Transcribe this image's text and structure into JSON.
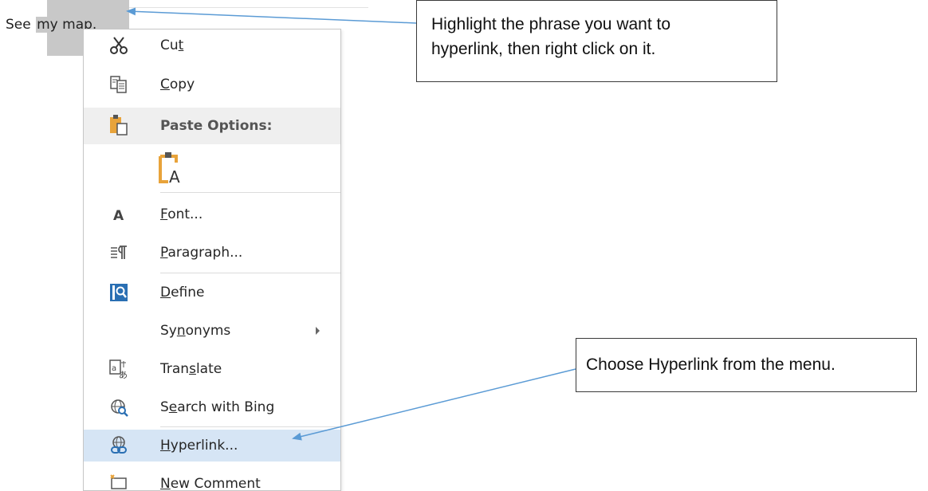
{
  "document": {
    "text_before": "See ",
    "selected_text": "my map."
  },
  "context_menu": {
    "items": [
      {
        "id": "cut",
        "label_pre": "Cu",
        "label_ul": "t",
        "label_post": "",
        "icon": "scissors-icon"
      },
      {
        "id": "copy",
        "label_pre": "",
        "label_ul": "C",
        "label_post": "opy",
        "icon": "copy-icon"
      },
      {
        "id": "paste-options",
        "label": "Paste Options:",
        "icon": "paste-icon"
      },
      {
        "id": "paste-keep-text",
        "icon": "paste-keep-text-only-icon"
      },
      {
        "id": "font",
        "label_pre": "",
        "label_ul": "F",
        "label_post": "ont...",
        "icon": "font-icon"
      },
      {
        "id": "paragraph",
        "label_pre": "",
        "label_ul": "P",
        "label_post": "aragraph...",
        "icon": "paragraph-icon"
      },
      {
        "id": "define",
        "label_pre": "",
        "label_ul": "D",
        "label_post": "efine",
        "icon": "define-icon"
      },
      {
        "id": "synonyms",
        "label_pre": "Sy",
        "label_ul": "n",
        "label_post": "onyms",
        "icon": ""
      },
      {
        "id": "translate",
        "label_pre": "Tran",
        "label_ul": "s",
        "label_post": "late",
        "icon": "translate-icon"
      },
      {
        "id": "search-bing",
        "label_pre": "S",
        "label_ul": "e",
        "label_post": "arch with Bing",
        "icon": "search-web-icon"
      },
      {
        "id": "hyperlink",
        "label_pre": "",
        "label_ul": "H",
        "label_post": "yperlink...",
        "icon": "hyperlink-icon"
      },
      {
        "id": "new-comment",
        "label_pre": "",
        "label_ul": "N",
        "label_post": "ew Comment",
        "icon": "new-comment-icon"
      }
    ]
  },
  "callouts": {
    "top_line1": "Highlight the phrase you want to",
    "top_line2": "hyperlink, then right click on it.",
    "bottom": "Choose Hyperlink from the menu."
  },
  "colors": {
    "selection": "#c8c8c8",
    "menu_highlight": "#d6e5f5",
    "arrow": "#5b9bd5",
    "accent_orange": "#e8a33a",
    "accent_blue": "#2a6fb3"
  }
}
